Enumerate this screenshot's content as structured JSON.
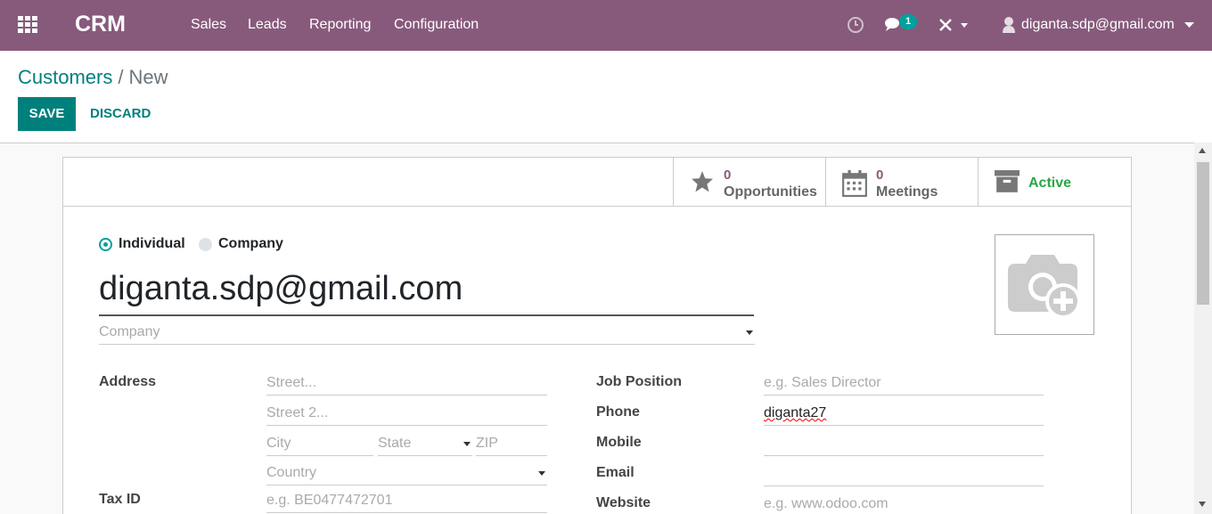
{
  "navbar": {
    "brand": "CRM",
    "menu": [
      "Sales",
      "Leads",
      "Reporting",
      "Configuration"
    ],
    "messages_count": "1",
    "user_email": "diganta.sdp@gmail.com",
    "color": "#875a7b"
  },
  "breadcrumb": {
    "parent": "Customers",
    "separator": "/",
    "current": "New"
  },
  "actions": {
    "save": "SAVE",
    "discard": "DISCARD"
  },
  "stat_buttons": {
    "opportunities": {
      "count": "0",
      "label": "Opportunities",
      "icon": "star-icon"
    },
    "meetings": {
      "count": "0",
      "label": "Meetings",
      "icon": "calendar-icon"
    },
    "active": {
      "label": "Active",
      "icon": "archive-icon"
    }
  },
  "company_type": {
    "individual": "Individual",
    "company": "Company",
    "selected": "individual"
  },
  "form": {
    "name": "diganta.sdp@gmail.com",
    "company_placeholder": "Company",
    "address_label": "Address",
    "street_placeholder": "Street...",
    "street2_placeholder": "Street 2...",
    "city_placeholder": "City",
    "state_placeholder": "State",
    "zip_placeholder": "ZIP",
    "country_placeholder": "Country",
    "tax_label": "Tax ID",
    "tax_placeholder": "e.g. BE0477472701",
    "job_label": "Job Position",
    "job_placeholder": "e.g. Sales Director",
    "phone_label": "Phone",
    "phone_value": "diganta27",
    "mobile_label": "Mobile",
    "email_label": "Email",
    "website_label": "Website",
    "website_placeholder": "e.g. www.odoo.com"
  }
}
